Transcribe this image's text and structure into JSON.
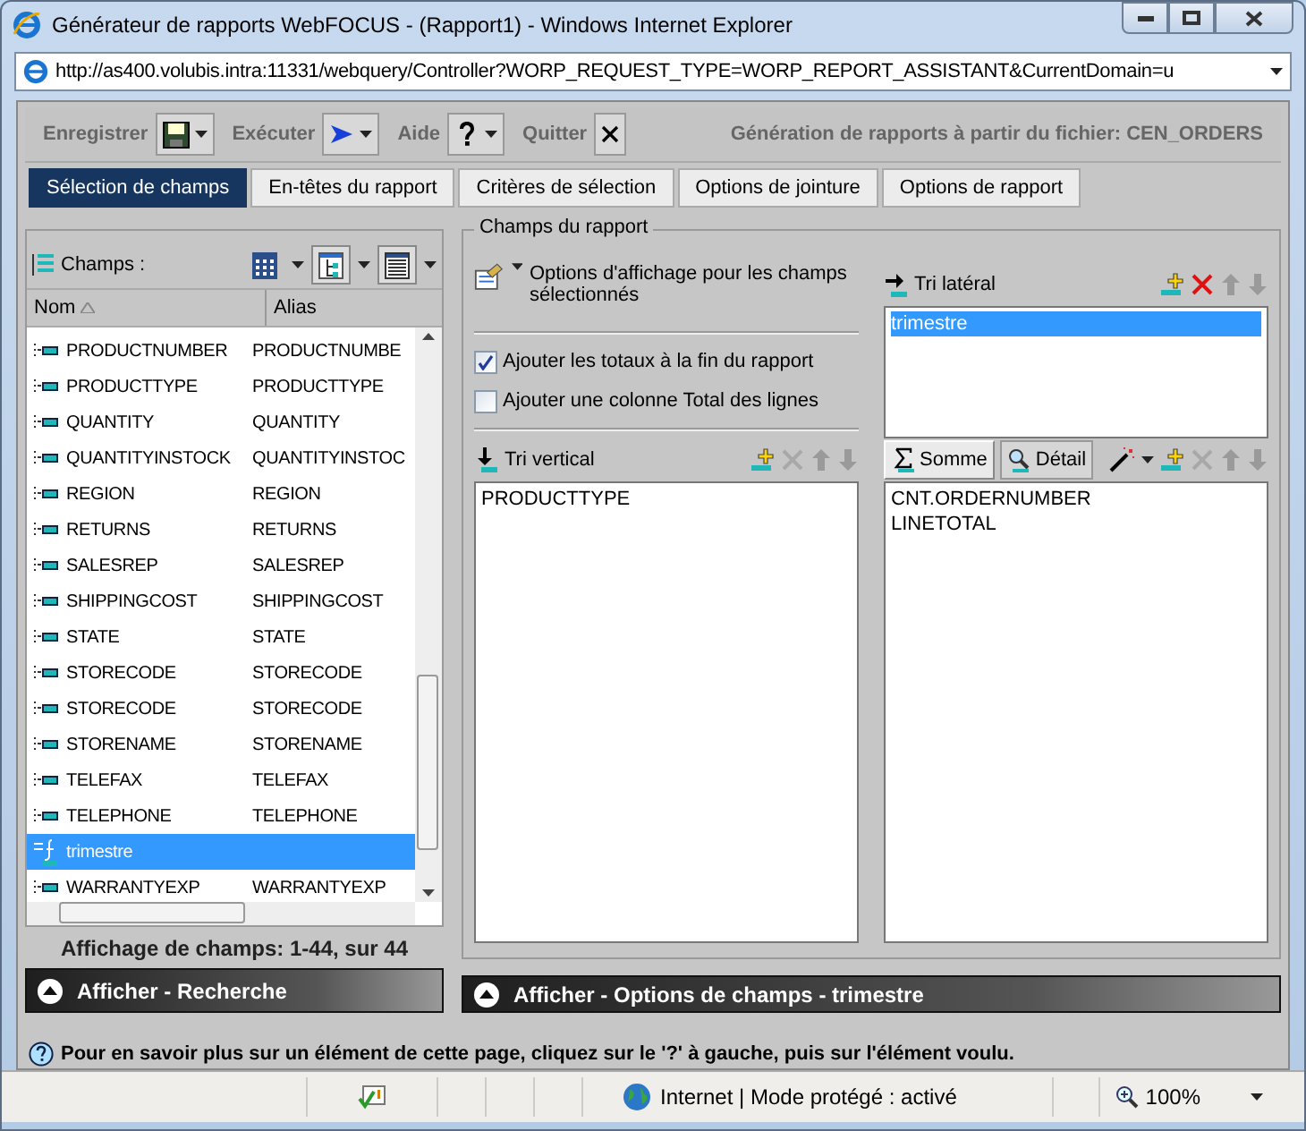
{
  "window": {
    "title": "Générateur de rapports WebFOCUS - (Rapport1) - Windows Internet Explorer",
    "url": "http://as400.volubis.intra:11331/webquery/Controller?WORP_REQUEST_TYPE=WORP_REPORT_ASSISTANT&CurrentDomain=u"
  },
  "toolbar": {
    "buttons": [
      {
        "label": "Enregistrer",
        "kind": "save"
      },
      {
        "label": "Exécuter",
        "kind": "run"
      },
      {
        "label": "Aide",
        "kind": "help"
      },
      {
        "label": "Quitter",
        "kind": "quit"
      }
    ],
    "title": "Génération de rapports à partir du fichier: CEN_ORDERS"
  },
  "tabs": [
    {
      "label": "Sélection de champs",
      "selected": true
    },
    {
      "label": "En-têtes du rapport",
      "selected": false
    },
    {
      "label": "Critères de sélection",
      "selected": false
    },
    {
      "label": "Options de jointure",
      "selected": false
    },
    {
      "label": "Options de rapport",
      "selected": false
    }
  ],
  "fields": {
    "label": "Champs :",
    "columns": [
      "Nom",
      "Alias"
    ],
    "rows": [
      {
        "name": "PRODUCTNUMBER",
        "alias": "PRODUCTNUMBE",
        "kind": "field",
        "selected": false
      },
      {
        "name": "PRODUCTTYPE",
        "alias": "PRODUCTTYPE",
        "kind": "field",
        "selected": false
      },
      {
        "name": "QUANTITY",
        "alias": "QUANTITY",
        "kind": "field",
        "selected": false
      },
      {
        "name": "QUANTITYINSTOCK",
        "alias": "QUANTITYINSTOC",
        "kind": "field",
        "selected": false
      },
      {
        "name": "REGION",
        "alias": "REGION",
        "kind": "field",
        "selected": false
      },
      {
        "name": "RETURNS",
        "alias": "RETURNS",
        "kind": "field",
        "selected": false
      },
      {
        "name": "SALESREP",
        "alias": "SALESREP",
        "kind": "field",
        "selected": false
      },
      {
        "name": "SHIPPINGCOST",
        "alias": "SHIPPINGCOST",
        "kind": "field",
        "selected": false
      },
      {
        "name": "STATE",
        "alias": "STATE",
        "kind": "field",
        "selected": false
      },
      {
        "name": "STORECODE",
        "alias": "STORECODE",
        "kind": "field",
        "selected": false
      },
      {
        "name": "STORECODE",
        "alias": "STORECODE",
        "kind": "field",
        "selected": false
      },
      {
        "name": "STORENAME",
        "alias": "STORENAME",
        "kind": "field",
        "selected": false
      },
      {
        "name": "TELEFAX",
        "alias": "TELEFAX",
        "kind": "field",
        "selected": false
      },
      {
        "name": "TELEPHONE",
        "alias": "TELEPHONE",
        "kind": "field",
        "selected": false
      },
      {
        "name": "trimestre",
        "kind": "computed",
        "selected": true
      },
      {
        "name": "WARRANTYEXP",
        "alias": "WARRANTYEXP",
        "kind": "field",
        "selected": false
      }
    ],
    "count": "Affichage de champs: 1-44, sur 44",
    "panel_button": "Afficher - Recherche"
  },
  "report": {
    "legend": "Champs du rapport",
    "display_options": "Options d'affichage pour les champs sélectionnés",
    "options": [
      {
        "label": "Ajouter les totaux à la fin du rapport",
        "checked": true
      },
      {
        "label": "Ajouter une colonne Total des lignes",
        "checked": false
      }
    ],
    "lateral": {
      "label": "Tri latéral",
      "items": [
        {
          "label": "trimestre",
          "selected": true
        }
      ]
    },
    "vertical": {
      "label": "Tri vertical",
      "items": [
        "PRODUCTTYPE"
      ]
    },
    "measures": {
      "modes": [
        {
          "label": "Somme",
          "selected": true
        },
        {
          "label": "Détail",
          "selected": false
        }
      ],
      "items": [
        "CNT.ORDERNUMBER",
        "LINETOTAL"
      ]
    },
    "panel_button": "Afficher - Options de champs - trimestre"
  },
  "help": "Pour en savoir plus sur un élément de cette page, cliquez sur le '?' à gauche, puis sur l'élément voulu.",
  "status": {
    "zone": "Internet | Mode protégé : activé",
    "zoom": "100%"
  }
}
